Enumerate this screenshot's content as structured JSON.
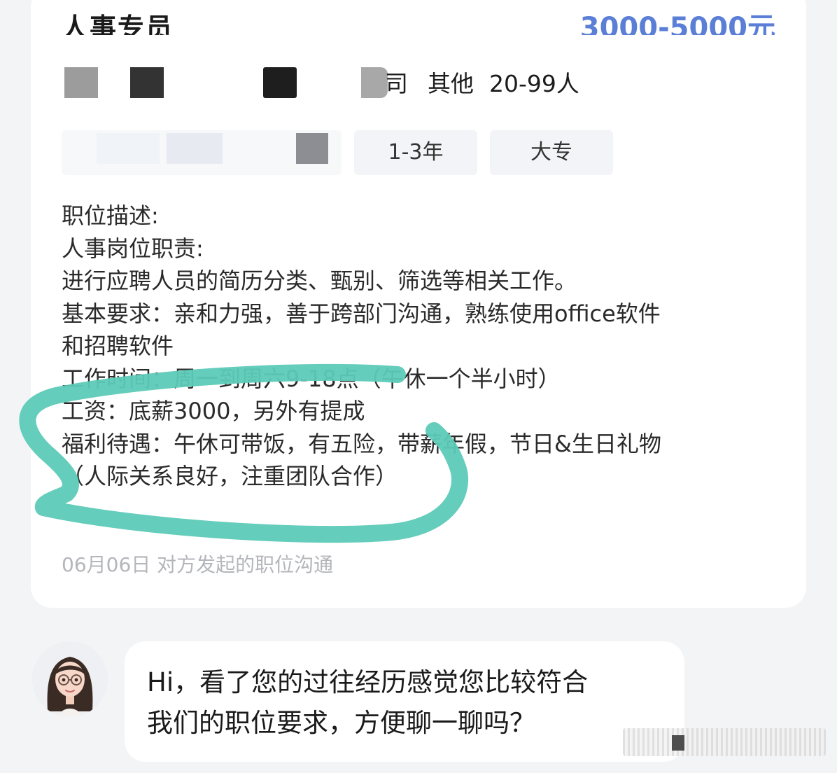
{
  "job": {
    "title": "人事专员",
    "salary": "3000-5000元",
    "company_tail": "司",
    "industry": "其他",
    "size": "20-99人",
    "tags": [
      "1-3年",
      "大专"
    ]
  },
  "description": {
    "lines": [
      "职位描述:",
      "人事岗位职责:",
      "进行应聘人员的简历分类、甄别、筛选等相关工作。",
      "基本要求：亲和力强，善于跨部门沟通，熟练使用office软件",
      "和招聘软件",
      "工作时间：周一到周六9-18点（午休一个半小时）",
      "工资：底薪3000，另外有提成",
      "福利待遇：午休可带饭，有五险，带薪年假，节日&生日礼物",
      "（人际关系良好，注重团队合作）"
    ]
  },
  "footnote": "06月06日 对方发起的职位沟通",
  "chat": {
    "lines": [
      "Hi，看了您的过往经历感觉您比较符合",
      "我们的职位要求，方便聊一聊吗？"
    ]
  },
  "colors": {
    "salary": "#5b7fd6",
    "highlight_marker": "#5ccab7",
    "footnote": "#b4b6ba"
  }
}
